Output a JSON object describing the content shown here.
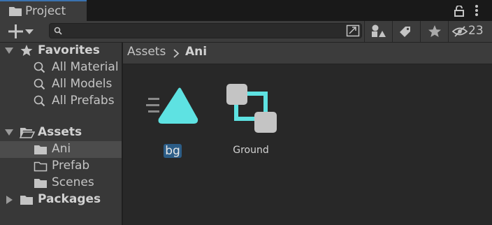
{
  "window": {
    "tab_title": "Project"
  },
  "toolbar": {
    "hidden_packages_count": "23",
    "search_value": ""
  },
  "tree": {
    "favorites": {
      "label": "Favorites",
      "items": [
        "All Material",
        "All Models",
        "All Prefabs"
      ]
    },
    "assets": {
      "label": "Assets",
      "children": [
        "Ani",
        "Prefab",
        "Scenes"
      ]
    },
    "packages": {
      "label": "Packages"
    }
  },
  "breadcrumb": {
    "root": "Assets",
    "current": "Ani"
  },
  "assets_grid": [
    {
      "name": "bg",
      "icon": "animator-controller-icon",
      "selected": true
    },
    {
      "name": "Ground",
      "icon": "animation-clip-icon",
      "selected": false
    }
  ],
  "colors": {
    "accent": "#3a72b0",
    "selection": "#2c5d87",
    "icon_teal": "#5ee2e2"
  }
}
